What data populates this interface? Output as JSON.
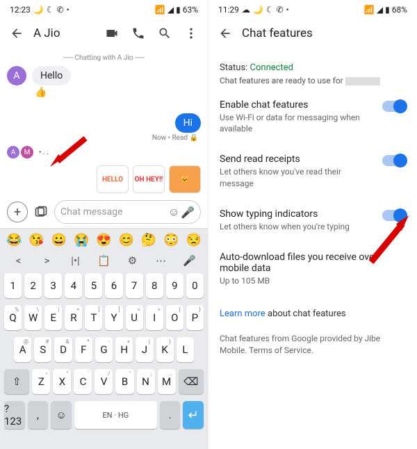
{
  "left": {
    "status": {
      "time": "12:23",
      "battery": "63%"
    },
    "header": {
      "title": "A Jio"
    },
    "system_line": "── Chatting with A Jio ──",
    "msg_in": {
      "avatar": "A",
      "text": "Hello",
      "reaction": "👍"
    },
    "msg_out": {
      "text": "Hi",
      "meta": "Now • Read 🔒"
    },
    "typing": {
      "a": "A",
      "m": "M"
    },
    "stickers": [
      "HELLO",
      "OH HEY!!",
      "🐱"
    ],
    "compose": {
      "placeholder": "Chat message"
    },
    "keyboard": {
      "emoji": [
        "😂",
        "😘",
        "😀",
        "😭",
        "😍",
        "😊",
        "🤔",
        "😳",
        "😒"
      ],
      "tools": [
        "<",
        ">",
        "|•|",
        "📋",
        "⚙",
        "⋯",
        "🎤"
      ],
      "nums": [
        "1",
        "2",
        "3",
        "4",
        "5",
        "6",
        "7",
        "8",
        "9",
        "0"
      ],
      "row1": [
        "Q",
        "W",
        "E",
        "R",
        "T",
        "Y",
        "U",
        "I",
        "O",
        "P"
      ],
      "row1_sup": [
        "%",
        "\\",
        "|",
        "=",
        "[",
        "]",
        "<",
        ">",
        "{",
        "}"
      ],
      "row2": [
        "A",
        "S",
        "D",
        "F",
        "G",
        "H",
        "J",
        "K",
        "L"
      ],
      "row2_sup": [
        "@",
        "#",
        "&",
        "*",
        "-",
        "+",
        "(",
        ")",
        ""
      ],
      "row3": [
        "Z",
        "X",
        "C",
        "V",
        "B",
        "N",
        "M"
      ],
      "row3_sup": [
        "•",
        "°",
        "`",
        "/",
        "\"",
        ";",
        "…"
      ],
      "shift": "⇧",
      "bksp": "⌫",
      "sym": "?123",
      "comma": ",",
      "smile": "☺",
      "space": "EN · HG",
      "period": ".",
      "enter": "↵"
    }
  },
  "right": {
    "status": {
      "time": "11:29",
      "battery": "68%"
    },
    "header": {
      "title": "Chat features"
    },
    "status_line_label": "Status: ",
    "status_value": "Connected",
    "status_sub": "Chat features are ready to use for ",
    "settings": [
      {
        "title": "Enable chat features",
        "sub": "Use Wi-Fi or data for messaging when available",
        "toggle": true
      },
      {
        "title": "Send read receipts",
        "sub": "Let others know you've read their message",
        "toggle": true
      },
      {
        "title": "Show typing indicators",
        "sub": "Let others know when you're typing",
        "toggle": true
      },
      {
        "title": "Auto-download files you receive over mobile data",
        "sub": "Up to 105 MB",
        "toggle": false
      }
    ],
    "learn_link": "Learn more",
    "learn_rest": " about chat features",
    "footer": "Chat features from Google provided by Jibe Mobile. Terms of Service."
  }
}
